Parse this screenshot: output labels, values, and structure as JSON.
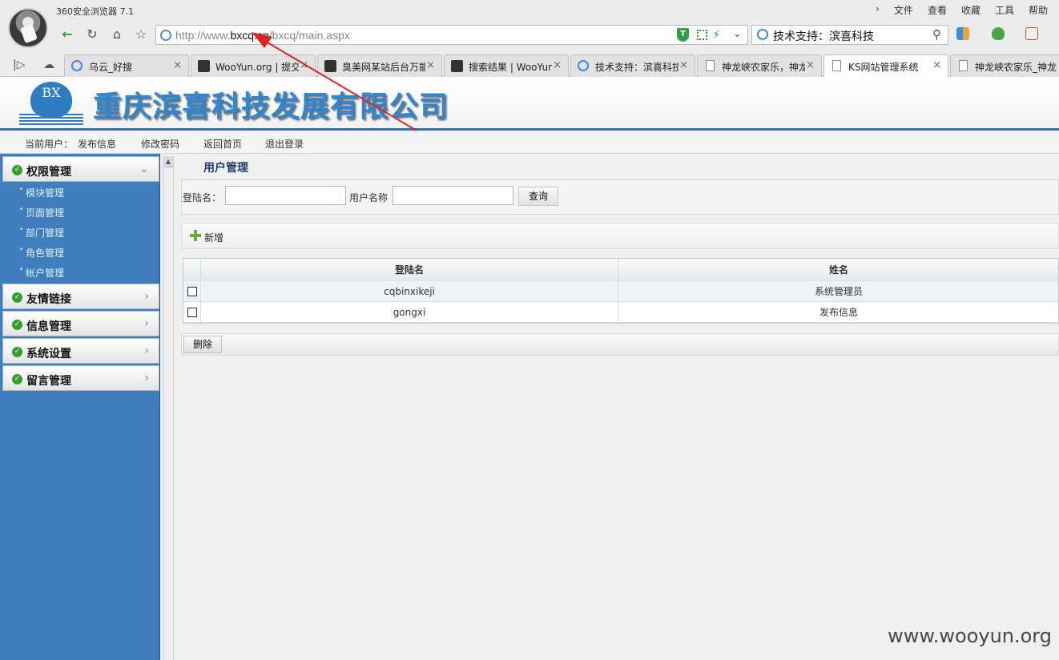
{
  "browser": {
    "title": "360安全浏览器 7.1",
    "menu": [
      "文件",
      "查看",
      "收藏",
      "工具",
      "帮助"
    ],
    "address": {
      "prefix": "http://www.",
      "host": "bxcq.cn",
      "path": "/bxcq/main.aspx"
    },
    "search_text": "技术支持：滨喜科技",
    "tabs": [
      {
        "label": "乌云_好搜",
        "icon": "search-icon"
      },
      {
        "label": "WooYun.org | 提交",
        "icon": "site-icon"
      },
      {
        "label": "臭美网某站后台万能",
        "icon": "site-icon"
      },
      {
        "label": "搜索结果 | WooYun",
        "icon": "site-icon"
      },
      {
        "label": "技术支持：滨喜科技",
        "icon": "search-icon"
      },
      {
        "label": "神龙峡农家乐，神龙",
        "icon": "page-icon"
      },
      {
        "label": "KS网站管理系统",
        "icon": "page-icon",
        "active": true
      },
      {
        "label": "神龙峡农家乐_神龙",
        "icon": "page-icon"
      }
    ]
  },
  "header": {
    "logo_text": "BX",
    "company": "重庆滨喜科技发展有限公司"
  },
  "userbar": {
    "current_user_label": "当前用户：",
    "current_user": "发布信息",
    "change_password": "修改密码",
    "home": "返回首页",
    "logout": "退出登录"
  },
  "sidebar": {
    "sections": [
      {
        "label": "权限管理",
        "expanded": true,
        "items": [
          "模块管理",
          "页面管理",
          "部门管理",
          "角色管理",
          "帐户管理"
        ]
      },
      {
        "label": "友情链接",
        "expanded": false
      },
      {
        "label": "信息管理",
        "expanded": false
      },
      {
        "label": "系统设置",
        "expanded": false
      },
      {
        "label": "留言管理",
        "expanded": false
      }
    ]
  },
  "main": {
    "title": "用户管理",
    "query": {
      "login_label": "登陆名：",
      "login_value": "",
      "name_label": "用户名称",
      "name_value": "",
      "search_button": "查询"
    },
    "add_button": "新增",
    "table": {
      "headers": [
        "登陆名",
        "姓名"
      ],
      "rows": [
        {
          "login": "cqbinxikeji",
          "name": "系统管理员"
        },
        {
          "login": "gongxi",
          "name": "发布信息"
        }
      ]
    },
    "delete_button": "删除"
  },
  "watermark": "www.wooyun.org",
  "colors": {
    "sidebar": "#3f7fbd",
    "accent": "#2f86d1",
    "arrow": "#e02424"
  }
}
